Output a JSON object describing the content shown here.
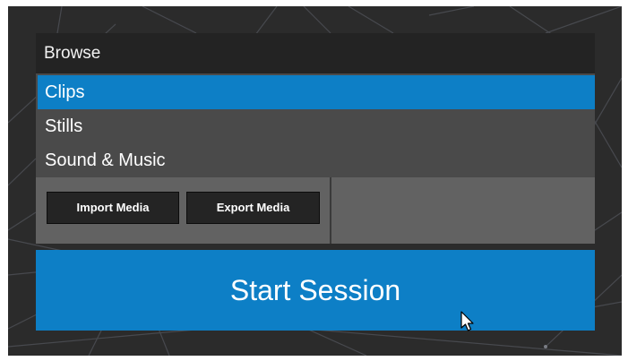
{
  "browse": {
    "header": "Browse",
    "items": [
      {
        "label": "Clips",
        "selected": true
      },
      {
        "label": "Stills",
        "selected": false
      },
      {
        "label": "Sound & Music",
        "selected": false
      }
    ]
  },
  "toolbar": {
    "import_label": "Import Media",
    "export_label": "Export Media"
  },
  "start_session": {
    "label": "Start Session"
  },
  "colors": {
    "accent": "#0d7fc6",
    "background": "#2b2b2b",
    "list_bg": "#4a4a4a",
    "toolbar_bg": "#626262",
    "button_bg": "#242424"
  },
  "icons": {
    "cursor": "mouse-pointer-icon",
    "background": "network-lines-background"
  }
}
